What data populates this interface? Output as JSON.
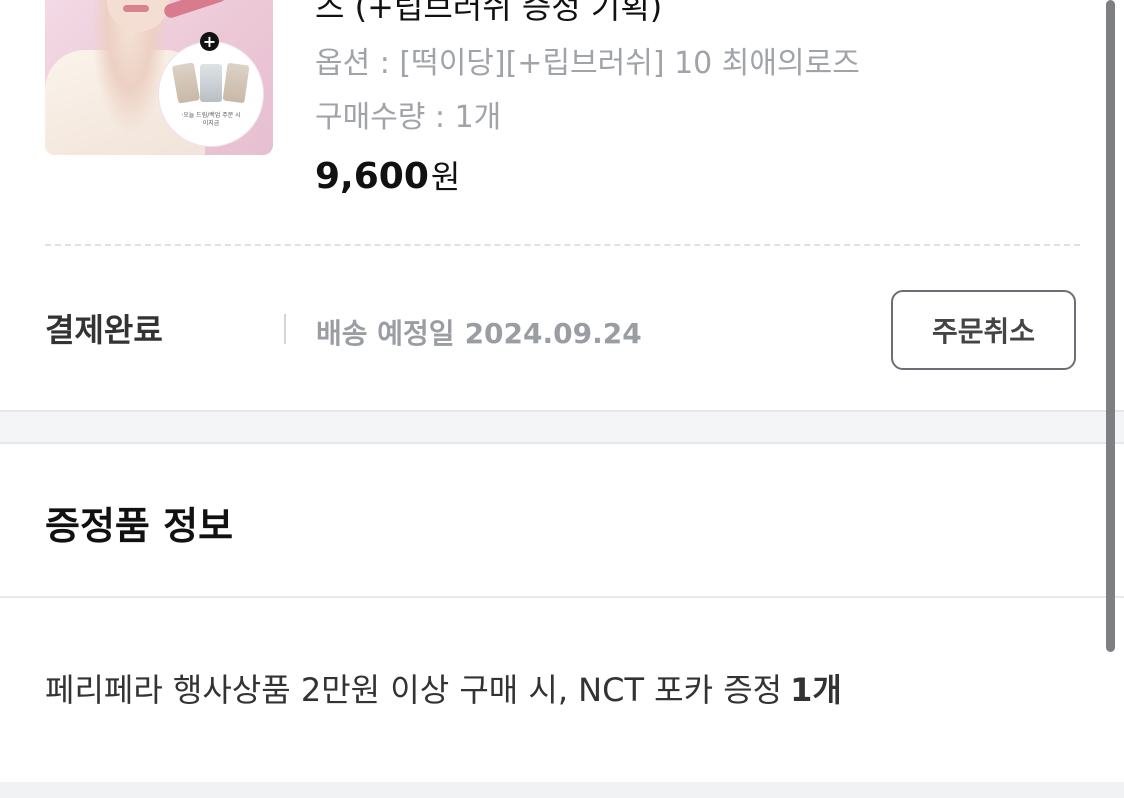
{
  "order_item": {
    "product_name_partial": "즈 (+립브러쉬 증정 기획)",
    "option_label": "옵션 :",
    "option_value": "[떡이당][+립브러쉬] 10 최애의로즈",
    "quantity_label": "구매수량 :",
    "quantity_value": "1개",
    "price": "9,600",
    "price_unit": "원",
    "thumbnail_caption": "·오늘 드림/백업 주문 시",
    "thumbnail_caption_2": "이지금"
  },
  "order_status": {
    "status": "결제완료",
    "delivery_label": "배송 예정일",
    "delivery_date": "2024.09.24",
    "cancel_button": "주문취소"
  },
  "gift_section": {
    "title": "증정품 정보",
    "description": "페리페라 행사상품 2만원 이상 구매 시, NCT 포카 증정",
    "count": "1개"
  },
  "colors": {
    "text_primary": "#111111",
    "text_muted": "#a0a3a8",
    "button_border": "#6b6f75",
    "section_gap": "#f4f5f7"
  }
}
